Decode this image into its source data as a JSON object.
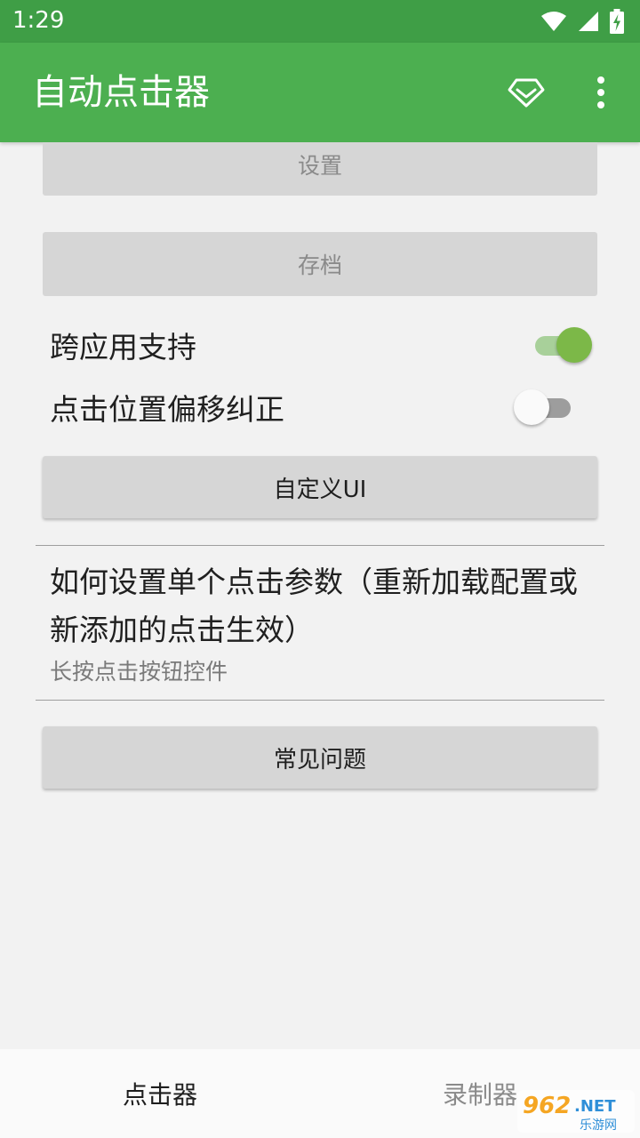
{
  "status_bar": {
    "time": "1:29"
  },
  "app_bar": {
    "title": "自动点击器",
    "icons": [
      "diamond-icon",
      "more-vert-icon"
    ]
  },
  "buttons": {
    "settings": "设置",
    "archive": "存档",
    "custom_ui": "自定义UI",
    "faq": "常见问题"
  },
  "toggles": [
    {
      "label": "跨应用支持",
      "on": true
    },
    {
      "label": "点击位置偏移纠正",
      "on": false
    }
  ],
  "help": {
    "title": "如何设置单个点击参数（重新加载配置或新添加的点击生效）",
    "subtitle": "长按点击按钮控件"
  },
  "bottom_nav": {
    "tabs": [
      {
        "label": "点击器",
        "active": true
      },
      {
        "label": "录制器",
        "active": false
      }
    ]
  },
  "watermark": {
    "text": "962.NET",
    "subtext": "乐游网"
  },
  "colors": {
    "primary": "#4caf50",
    "status_bar": "#3f9e46",
    "switch_on": "#7cb848",
    "background": "#f2f2f2"
  }
}
